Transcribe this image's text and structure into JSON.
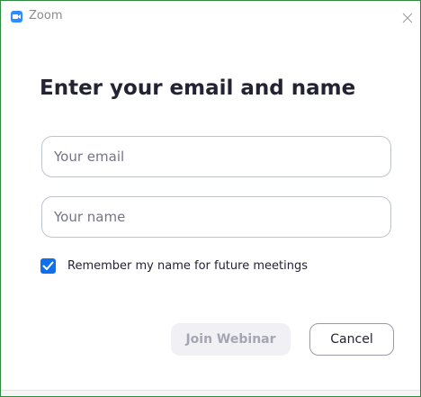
{
  "window": {
    "title": "Zoom",
    "icon": "zoom-camera-icon",
    "close_icon": "close-icon"
  },
  "form": {
    "heading": "Enter your email and name",
    "email": {
      "placeholder": "Your email",
      "value": ""
    },
    "name": {
      "placeholder": "Your name",
      "value": ""
    },
    "remember": {
      "label": "Remember my name for future meetings",
      "checked": true
    }
  },
  "actions": {
    "join_label": "Join Webinar",
    "join_enabled": false,
    "cancel_label": "Cancel"
  },
  "colors": {
    "accent": "#0e71eb",
    "brand": "#2d8cff",
    "window_border": "#2e8b3d",
    "disabled_text": "#a6a6b1"
  }
}
